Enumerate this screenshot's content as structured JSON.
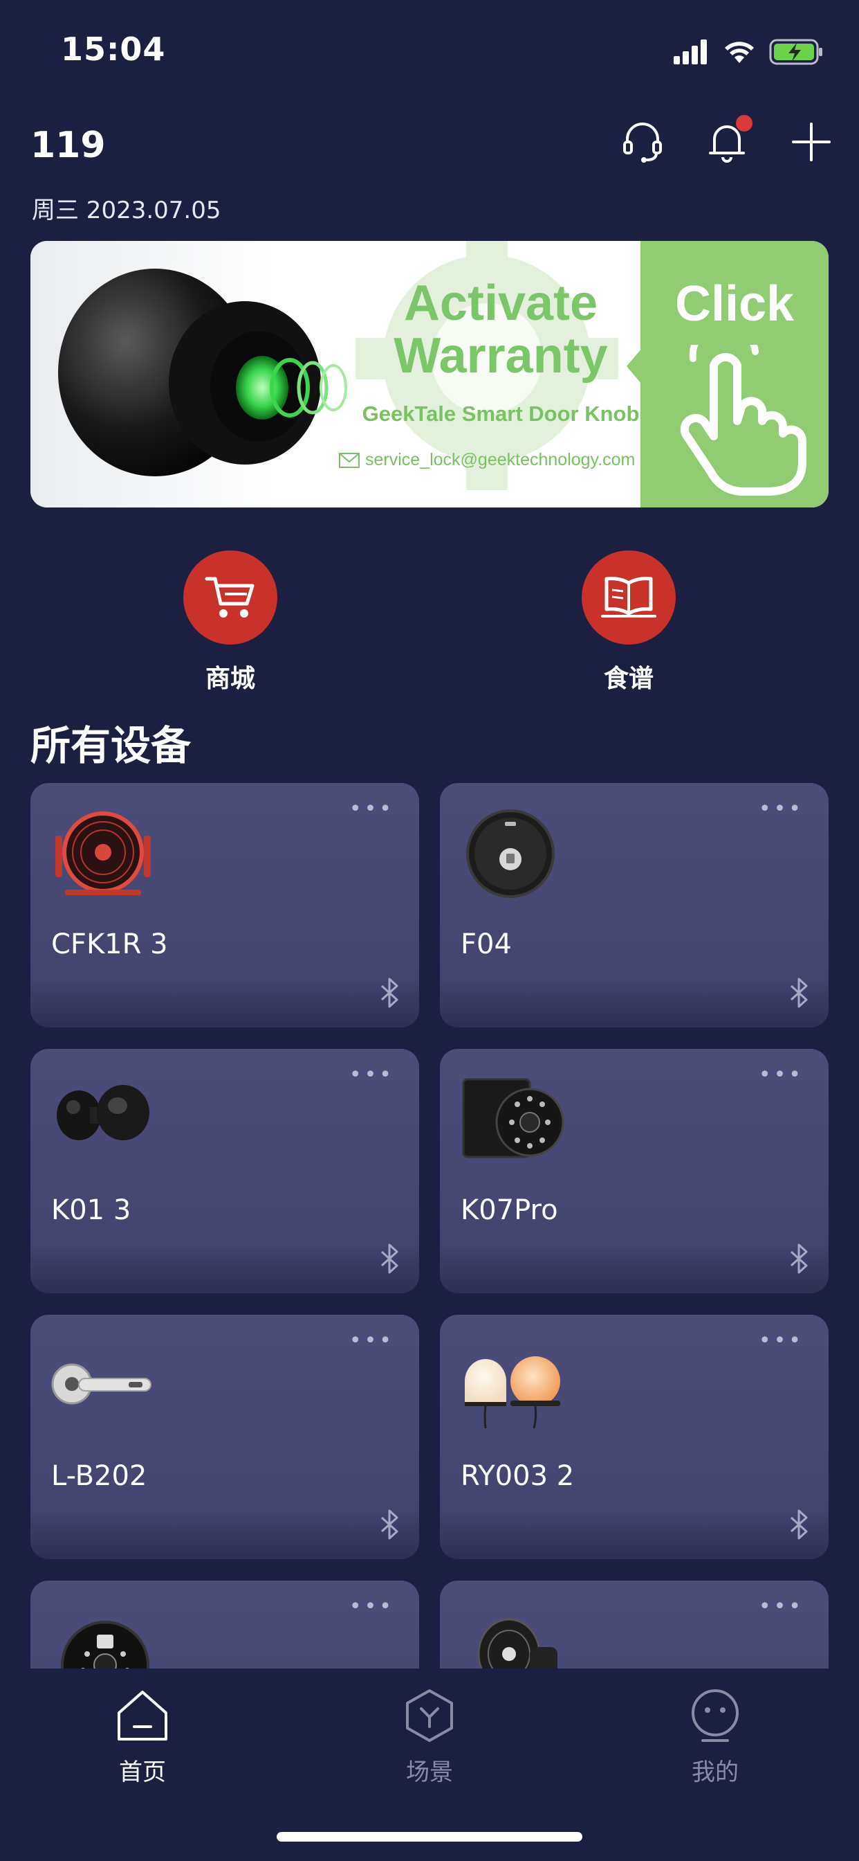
{
  "status": {
    "time": "15:04"
  },
  "header": {
    "title": "119",
    "date": "周三  2023.07.05"
  },
  "banner": {
    "headline_line1": "Activate",
    "headline_line2": "Warranty",
    "product": "GeekTale Smart Door Knob",
    "email": "service_lock@geektechnology.com",
    "cta": "Click"
  },
  "quick_actions": [
    {
      "label": "商城",
      "icon": "cart-icon"
    },
    {
      "label": "食谱",
      "icon": "book-icon"
    }
  ],
  "section_title": "所有设备",
  "devices": [
    {
      "name": "CFK1R 3",
      "icon": "fan-icon"
    },
    {
      "name": "F04",
      "icon": "round-device-icon"
    },
    {
      "name": "K01 3",
      "icon": "door-knob-icon"
    },
    {
      "name": "K07Pro",
      "icon": "keypad-knob-icon"
    },
    {
      "name": "L-B202",
      "icon": "lever-lock-icon"
    },
    {
      "name": "RY003 2",
      "icon": "lamp-icon"
    },
    {
      "name": "",
      "icon": "keypad-lock-icon"
    },
    {
      "name": "",
      "icon": "desk-fan-icon"
    }
  ],
  "tabs": [
    {
      "label": "首页",
      "active": true
    },
    {
      "label": "场景",
      "active": false
    },
    {
      "label": "我的",
      "active": false
    }
  ],
  "colors": {
    "background": "#1b2043",
    "card": "#4c4d79",
    "accent_red": "#c8322b",
    "banner_green": "#8fcc72",
    "inactive_tab": "#8a8ca6"
  }
}
